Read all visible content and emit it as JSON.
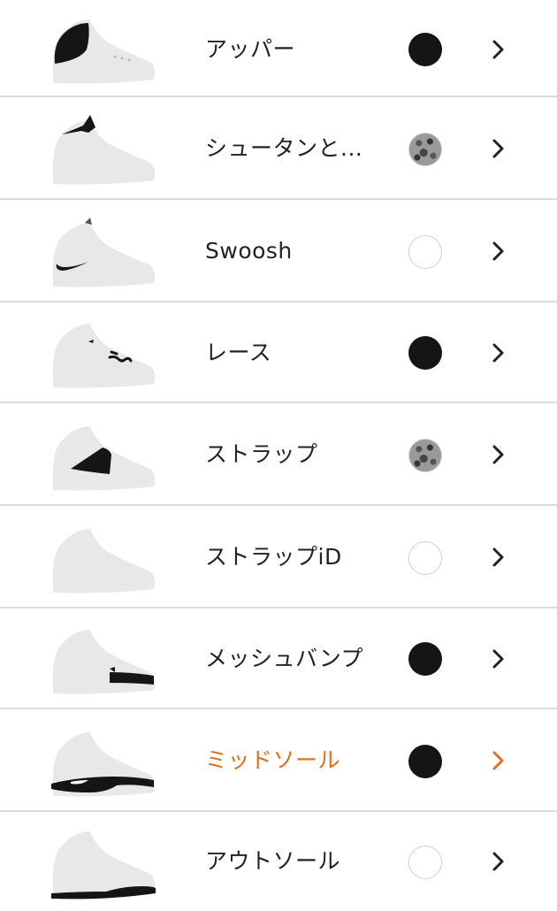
{
  "parts": [
    {
      "label": "アッパー",
      "color": "black",
      "active": false,
      "highlight": "upper"
    },
    {
      "label": "シュータンと...",
      "color": "pattern",
      "active": false,
      "highlight": "tongue"
    },
    {
      "label": "Swoosh",
      "color": "white",
      "active": false,
      "highlight": "swoosh"
    },
    {
      "label": "レース",
      "color": "black",
      "active": false,
      "highlight": "laces"
    },
    {
      "label": "ストラップ",
      "color": "pattern",
      "active": false,
      "highlight": "strap"
    },
    {
      "label": "ストラップiD",
      "color": "white",
      "active": false,
      "highlight": "none"
    },
    {
      "label": "メッシュバンプ",
      "color": "black",
      "active": false,
      "highlight": "mesh"
    },
    {
      "label": "ミッドソール",
      "color": "black",
      "active": true,
      "highlight": "midsole"
    },
    {
      "label": "アウトソール",
      "color": "white",
      "active": false,
      "highlight": "outsole"
    }
  ],
  "colors": {
    "accent": "#e0701c",
    "text": "#222222",
    "divider": "#dcdcdc",
    "shoe_base": "#e8e8e8",
    "shoe_highlight": "#111111"
  },
  "icons": {
    "row_chevron": "chevron-right-icon",
    "thumbnail": "shoe-icon"
  }
}
